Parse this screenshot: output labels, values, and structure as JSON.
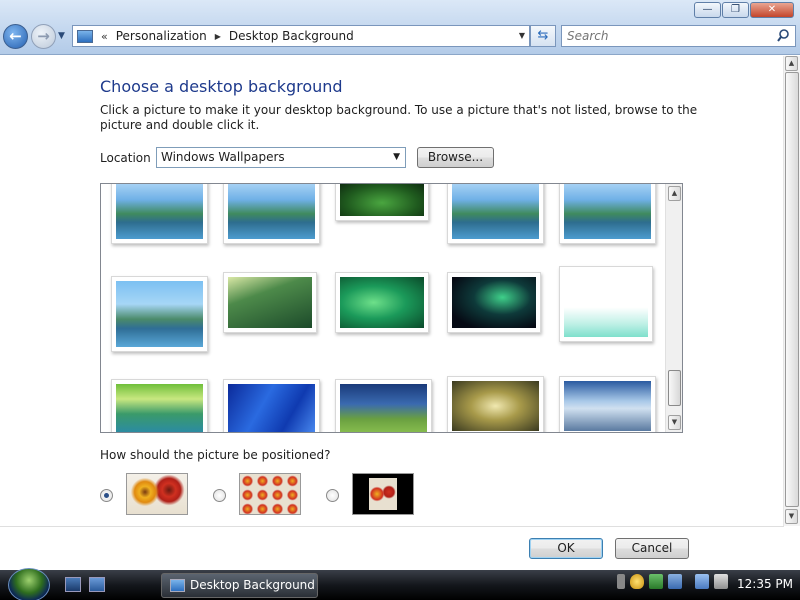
{
  "window": {
    "controls": {
      "minimize": "—",
      "maximize": "❐",
      "close": "✕"
    }
  },
  "address": {
    "chevron": "«",
    "crumbs": [
      "Personalization",
      "Desktop Background"
    ]
  },
  "search": {
    "placeholder": "Search"
  },
  "page": {
    "heading": "Choose a desktop background",
    "description": "Click a picture to make it your desktop background. To use a picture that's not listed, browse to the picture and double click it.",
    "location_label": "Location",
    "location_value": "Windows Wallpapers",
    "browse_label": "Browse...",
    "position_question": "How should the picture be positioned?",
    "position_selected": "fill"
  },
  "buttons": {
    "ok": "OK",
    "cancel": "Cancel"
  },
  "taskbar": {
    "task_label": "Desktop Background",
    "clock": "12:35 PM"
  },
  "colors": {
    "heading": "#1e3a8c",
    "titlebar": "#c2d6ee",
    "taskbar": "#14171c"
  }
}
